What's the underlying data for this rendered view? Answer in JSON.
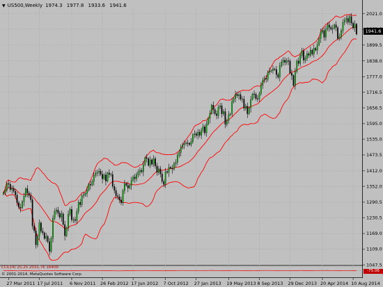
{
  "header": {
    "dropdown_icon": "chevron-down-icon",
    "symbol": "US500,Weekly",
    "open": "1974.3",
    "high": "1977.8",
    "low": "1933.6",
    "close": "1941.6"
  },
  "last_price": "1941.6",
  "indicator": {
    "label": "CCI(14) 25.25 2031.76 16408",
    "value_badge": "-75.06"
  },
  "copyright": "© 2001-2014, MetaQuotes Software Corp.",
  "colors": {
    "background": "#c0c0c0",
    "grid": "#a8a8a8",
    "candle_bull": "#00b000",
    "candle_bear": "#000000",
    "bands": "#ff0000",
    "price_label_bg": "#000000"
  },
  "chart_data": [
    {
      "type": "candlestick",
      "title": "US500,Weekly",
      "timeframe": "Weekly",
      "ylim": [
        1047.9,
        2041.9
      ],
      "y_ticks": [
        "2021.0",
        "1961.0",
        "1899.5",
        "1838.0",
        "1777.0",
        "1716.5",
        "1656.5",
        "1595.0",
        "1535.0",
        "1473.5",
        "1412.0",
        "1352.0",
        "1290.5",
        "1230.5",
        "1169.0",
        "1109.0",
        "1047.5"
      ],
      "x_ticks": [
        "27 Mar 2011",
        "17 Jul 2011",
        "6 Nov 2011",
        "26 Feb 2012",
        "17 Jun 2012",
        "7 Oct 2012",
        "27 Jan 2013",
        "19 May 2013",
        "8 Sep 2013",
        "29 Dec 2013",
        "20 Apr 2014",
        "10 Aug 2014"
      ],
      "series": [
        {
          "name": "",
          "kind": "close",
          "x_start": "27 Mar 2011",
          "x_step": "1 week",
          "values": [
            1328,
            1337,
            1363,
            1360,
            1339,
            1344,
            1333,
            1318,
            1288,
            1271,
            1268,
            1293,
            1313,
            1343,
            1326,
            1316,
            1300,
            1198,
            1180,
            1125,
            1158,
            1210,
            1178,
            1172,
            1150,
            1158,
            1138,
            1100,
            1150,
            1228,
            1255,
            1260,
            1248,
            1232,
            1245,
            1204,
            1160,
            1192,
            1244,
            1263,
            1222,
            1223,
            1219,
            1255,
            1290,
            1281,
            1315,
            1318,
            1325,
            1337,
            1360,
            1357,
            1371,
            1395,
            1403,
            1406,
            1411,
            1399,
            1381,
            1396,
            1372,
            1404,
            1398,
            1398,
            1352,
            1336,
            1315,
            1312,
            1299,
            1288,
            1335,
            1363,
            1356,
            1345,
            1356,
            1375,
            1388,
            1381,
            1397,
            1407,
            1414,
            1408,
            1436,
            1463,
            1460,
            1433,
            1455,
            1438,
            1459,
            1431,
            1406,
            1420,
            1400,
            1371,
            1359,
            1409,
            1406,
            1426,
            1422,
            1419,
            1440,
            1445,
            1472,
            1483,
            1502,
            1513,
            1517,
            1520,
            1519,
            1514,
            1525,
            1552,
            1556,
            1549,
            1562,
            1550,
            1568,
            1583,
            1559,
            1593,
            1614,
            1633,
            1667,
            1650,
            1633,
            1626,
            1659,
            1664,
            1633,
            1642,
            1592,
            1607,
            1630,
            1632,
            1680,
            1692,
            1709,
            1703,
            1707,
            1690,
            1690,
            1655,
            1663,
            1633,
            1656,
            1688,
            1710,
            1709,
            1692,
            1691,
            1711,
            1744,
            1762,
            1770,
            1767,
            1794,
            1799,
            1800,
            1807,
            1805,
            1785,
            1775,
            1819,
            1834,
            1841,
            1832,
            1839,
            1838,
            1791,
            1782,
            1742,
            1797,
            1838,
            1828,
            1859,
            1877,
            1841,
            1849,
            1866,
            1860,
            1880,
            1865,
            1887,
            1880,
            1900,
            1924,
            1950,
            1956,
            1930,
            1962,
            1978,
            1968,
            1961,
            1964,
            1978,
            1967,
            1925,
            1931,
            1955,
            1988,
            1996,
            2003,
            1988,
            2010,
            1985,
            1966,
            1981,
            1941.6
          ]
        },
        {
          "name": "",
          "kind": "bollinger_upper",
          "color": "#ff0000"
        },
        {
          "name": "",
          "kind": "bollinger_middle",
          "color": "#ff0000"
        },
        {
          "name": "",
          "kind": "bollinger_lower",
          "color": "#ff0000"
        }
      ]
    },
    {
      "type": "line",
      "title": "CCI(14) 25.25 2031.76 16408",
      "ylim": [
        -300,
        300
      ],
      "series": [
        {
          "name": "",
          "color": "#ff0000"
        }
      ]
    }
  ]
}
